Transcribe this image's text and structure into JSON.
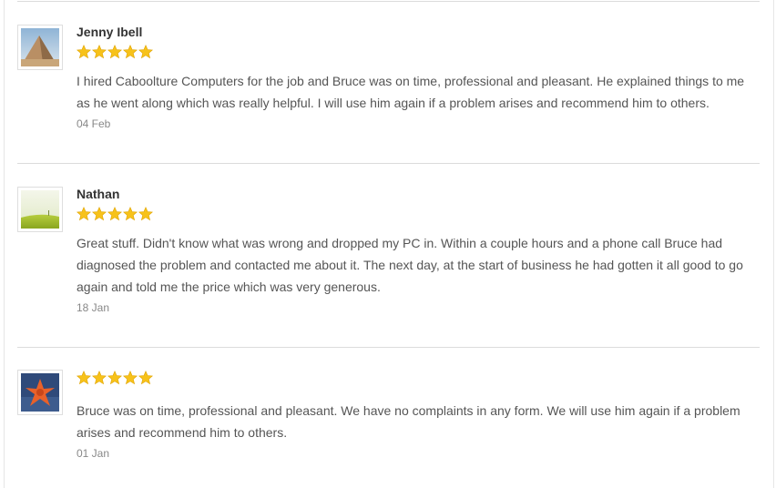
{
  "reviews": [
    {
      "name": "Jenny Ibell",
      "rating": 5,
      "text": "I hired Caboolture Computers for the job and Bruce was on time, professional and pleasant. He explained things to me as he went along which was really helpful. I will use him again if a problem arises and recommend him to others.",
      "date": "04 Feb",
      "avatar": "pyramids-photo"
    },
    {
      "name": "Nathan",
      "rating": 5,
      "text": "Great stuff. Didn't know what was wrong and dropped my PC in. Within a couple hours and a phone call Bruce had diagnosed the problem and contacted me about it. The next day, at the start of business he had gotten it all good to go again and told me the price which was very generous.",
      "date": "18 Jan",
      "avatar": "green-field-photo"
    },
    {
      "name": "",
      "rating": 5,
      "text": "Bruce was on time, professional and pleasant. We have no complaints in any form. We will use him again if a problem arises and recommend him to others.",
      "date": "01 Jan",
      "avatar": "starfish-photo"
    }
  ],
  "colors": {
    "star": "#f7c21a",
    "star_edge": "#e0a300",
    "name": "#333333",
    "text": "#555555",
    "date": "#888888",
    "divider": "#dcdcdc"
  }
}
